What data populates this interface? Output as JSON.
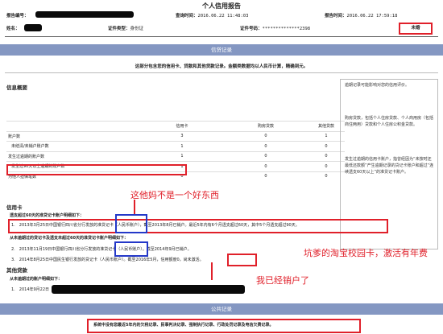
{
  "title": "个人信用报告",
  "header": {
    "report_no_label": "报告编号：",
    "query_time_label": "查询时间：",
    "query_time": "2016.06.22 11:48:03",
    "report_time_label": "报告时间：",
    "report_time": "2016.06.22 17:59:18",
    "name_label": "姓名：",
    "id_type_label": "证件类型：",
    "id_type": "身份证",
    "id_no_label": "证件号码：",
    "id_no": "**************2398",
    "marital": "未婚"
  },
  "credit_section": {
    "bar_label": "信贷记录",
    "note": "这部分包含您的信用卡、贷款和其他贷款记录。金额类数据均以人民币计算，精确到元。"
  },
  "overview": {
    "heading": "信息概要",
    "columns": [
      "信用卡",
      "购房贷款",
      "其他贷款"
    ],
    "rows": [
      {
        "label": "账户数",
        "values": [
          "3",
          "0",
          "1"
        ]
      },
      {
        "label": "未结清/未销户账户数",
        "values": [
          "1",
          "0",
          "0"
        ]
      },
      {
        "label": "发生过逾期的账户数",
        "values": [
          "1",
          "0",
          "0"
        ]
      },
      {
        "label": "发生过90天以上逾期的账户数",
        "values": [
          "1",
          "0",
          "0"
        ]
      },
      {
        "label": "为他人担保笔数",
        "values": [
          "0",
          "0",
          "0"
        ]
      }
    ]
  },
  "side_notes": {
    "p1": "逾期记录可能影响对您的信用评价。",
    "p2": "购房贷款，包括个人住房贷款、个人商用房（包括商住两用）贷款和个人住房公积金贷款。",
    "p3": "发生过逾期的信用卡账户，指曾经因为“未按时还最低还款额”产生逾期记录的贷记卡账户和超过“连续透支60天以上”的准贷记卡账户。"
  },
  "credit_card": {
    "heading": "信用卡",
    "overdue_heading": "透支超过60天的准贷记卡账户明细如下：",
    "overdue_item": "1.　2013年3月25日中国银行四川省分行发放的准贷记卡（人民币账户），截至2013年8月已销户。最近5年内有6个月透支超过60天，其中5个月透支超过90天。",
    "no_overdue_heading": "从未逾期过的贷记卡及透支未超过60天的准贷记卡账户明细如下：",
    "items": [
      "2.　2013年11月19日中国银行四川省分行发放的准贷记卡（人民币账户）。截至2014年9月已销户。",
      "3.　2014年8月25日中国民生银行发放的贷记卡（人民币账户）。截至2016年5月，信用额度0，尚未激活。"
    ],
    "not_activated": "尚未激活"
  },
  "other_loans": {
    "heading": "其他贷款",
    "subheading": "从未逾期过的账户明细如下：",
    "item_prefix": "1.　2014年9月22日"
  },
  "public_section": {
    "bar_label": "公共记录",
    "note": "系统中没有您最近5年内的欠税记录、民事判决记录、强制执行记录、行政处罚记录及电信欠费记录。"
  },
  "annotations": {
    "a1": "这他妈不是一个好东西",
    "a2": "坑爹的淘宝校园卡，激活有年费",
    "a3": "我已经销户了"
  },
  "colors": {
    "annotation": "#e0202a",
    "highlight_blue": "#2438c8",
    "section_bar": "#8497c2"
  }
}
